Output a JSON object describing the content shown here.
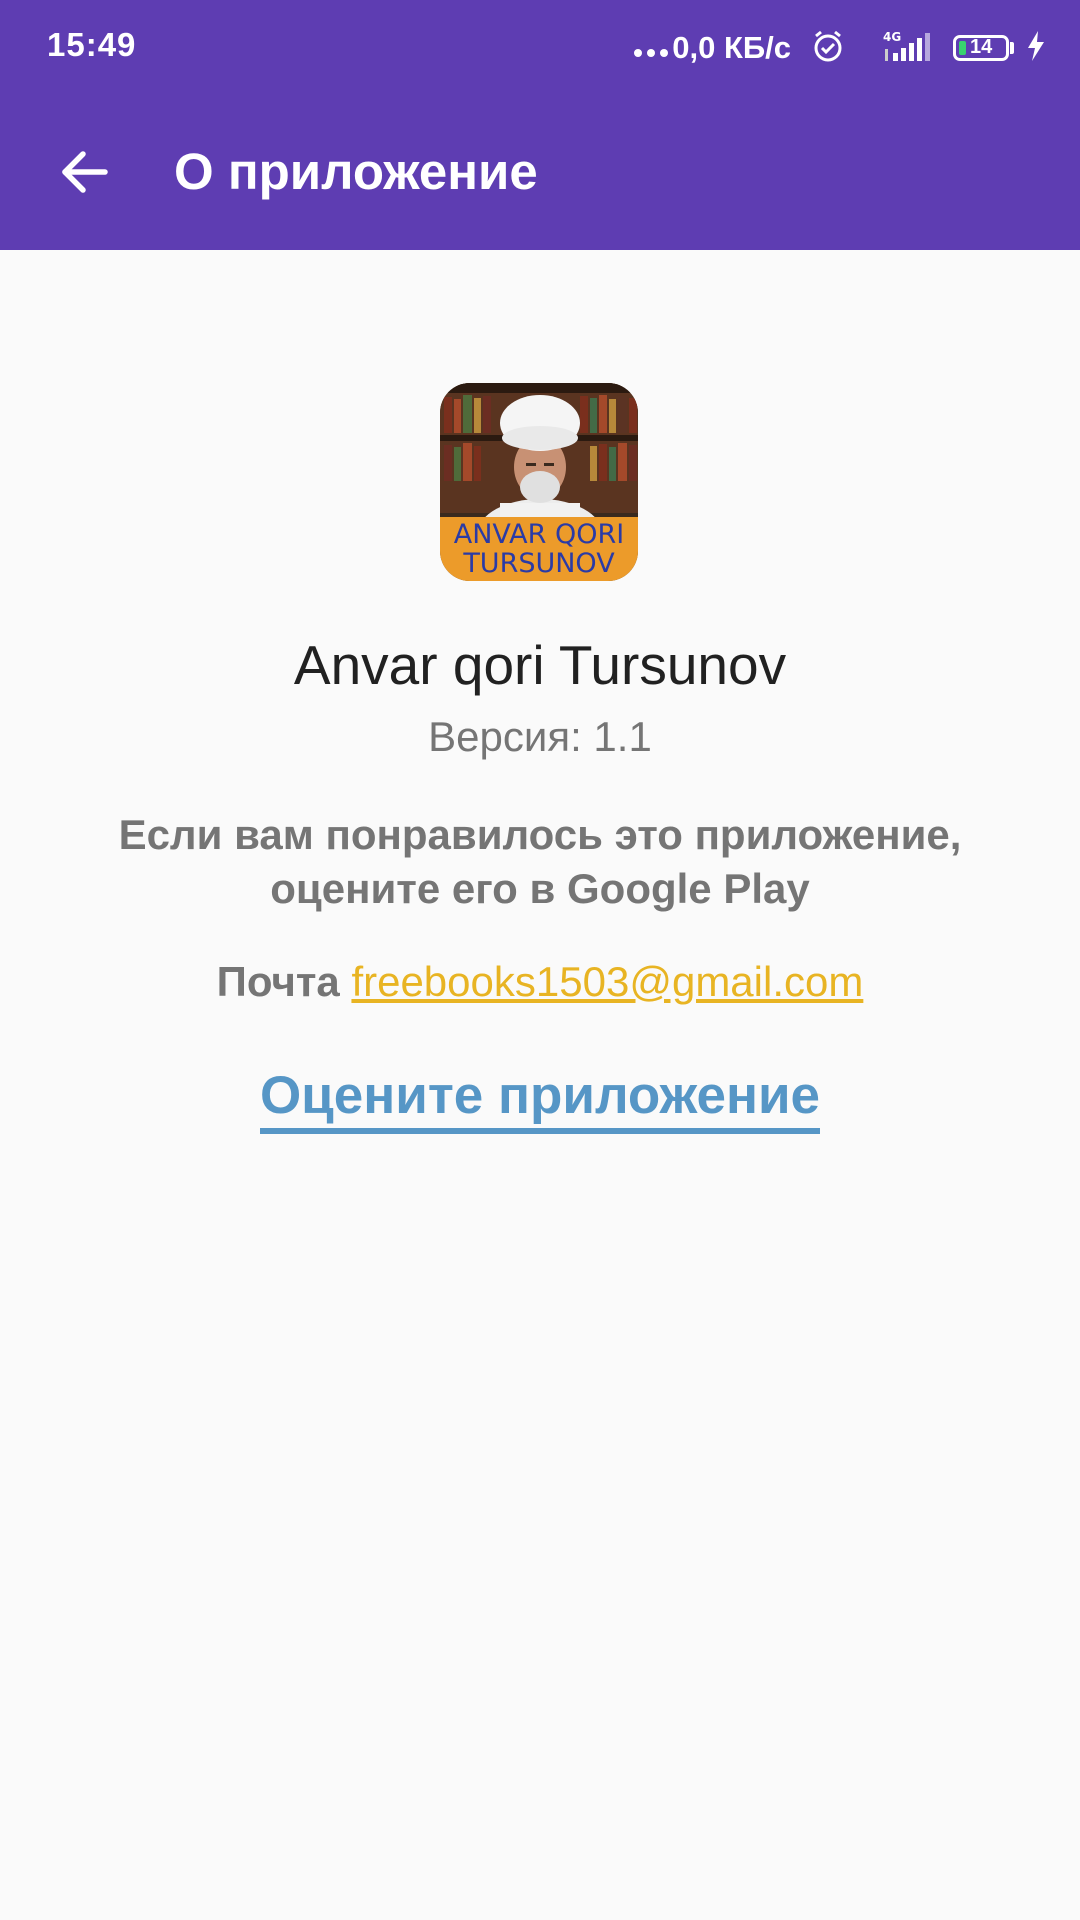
{
  "status_bar": {
    "time": "15:49",
    "net_speed": "0,0 КБ/с",
    "network_type": "4G",
    "battery_level": "14",
    "icons": [
      "dots-icon",
      "alarm-icon",
      "signal-icon",
      "battery-icon",
      "charging-icon"
    ]
  },
  "toolbar": {
    "back_icon": "arrow-left-icon",
    "title": "О приложение",
    "background_color": "#5e3db2"
  },
  "app": {
    "icon_label": "ANVAR QORI TURSUNOV",
    "icon_label_line1": "ANVAR QORI",
    "icon_label_line2": "TURSUNOV",
    "name": "Anvar qori Tursunov",
    "version_label": "Версия: 1.1"
  },
  "content": {
    "rate_prompt": "Если вам понравилось это приложение, оцените его в Google Play",
    "mail_label": "Почта",
    "mail_address": "freebooks1503@gmail.com",
    "rate_link": "Оцените приложение"
  },
  "colors": {
    "accent": "#5e3db2",
    "link_mail": "#e8b423",
    "link_rate": "#5696c6",
    "background": "#fafafa"
  }
}
